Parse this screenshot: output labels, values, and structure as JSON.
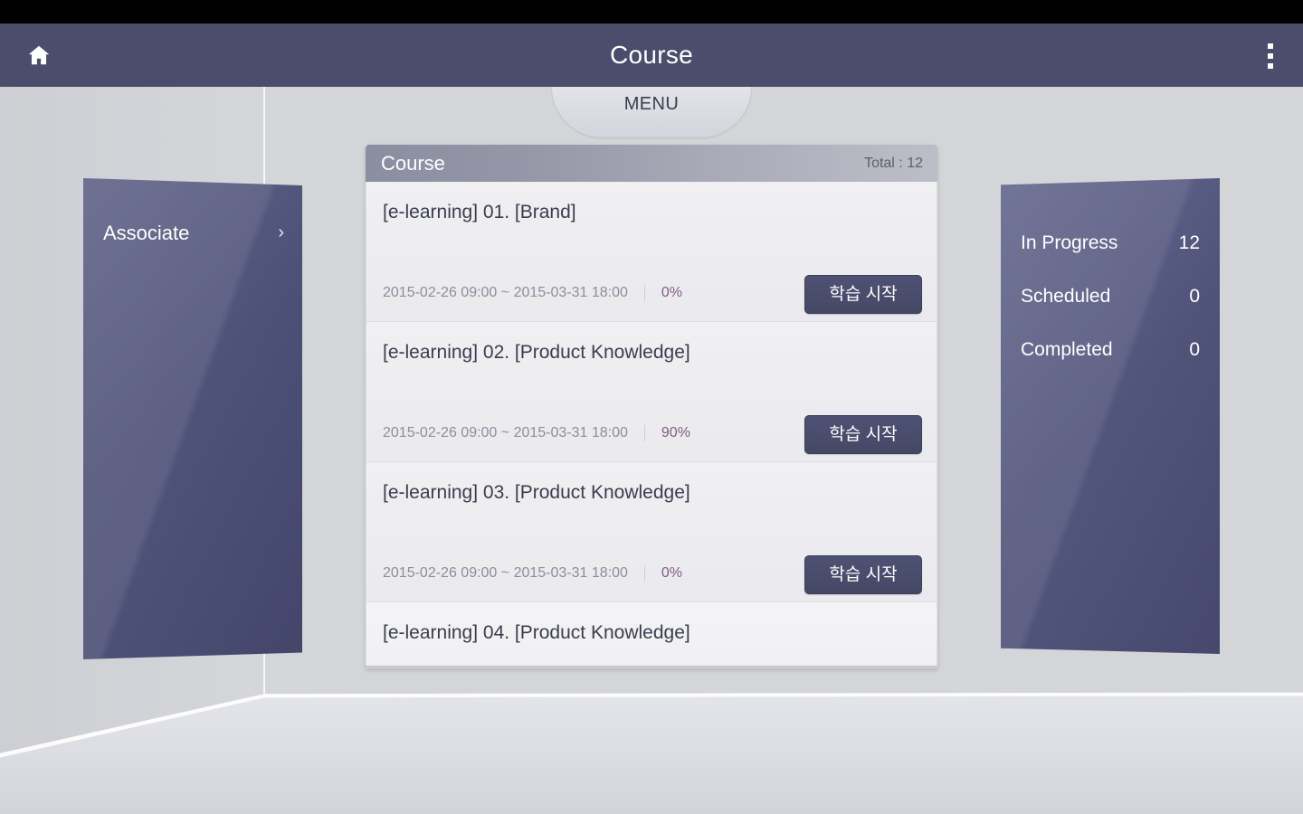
{
  "app_bar": {
    "title": "Course",
    "home_icon": "home-icon",
    "overflow_icon": "more-vert-icon"
  },
  "menu_tab": {
    "label": "MENU"
  },
  "left_panel": {
    "label": "Associate",
    "chevron_icon": "chevron-right-icon"
  },
  "right_panel": {
    "stats": [
      {
        "label": "In Progress",
        "value": "12"
      },
      {
        "label": "Scheduled",
        "value": "0"
      },
      {
        "label": "Completed",
        "value": "0"
      }
    ]
  },
  "course_card": {
    "header_title": "Course",
    "total_label": "Total : 12",
    "items": [
      {
        "title": "[e-learning]  01. [Brand]",
        "dates": "2015-02-26 09:00 ~ 2015-03-31 18:00",
        "progress": "0%",
        "button_label": "학습 시작"
      },
      {
        "title": "[e-learning]  02. [Product Knowledge]",
        "dates": "2015-02-26 09:00 ~ 2015-03-31 18:00",
        "progress": "90%",
        "button_label": "학습 시작"
      },
      {
        "title": "[e-learning]  03. [Product Knowledge]",
        "dates": "2015-02-26 09:00 ~ 2015-03-31 18:00",
        "progress": "0%",
        "button_label": "학습 시작"
      },
      {
        "title": "[e-learning]  04. [Product Knowledge]",
        "dates": "",
        "progress": "",
        "button_label": ""
      }
    ]
  },
  "colors": {
    "app_bar": "#4a4d6b",
    "panel_purple": "#4c4f76",
    "button_navy": "#474a64",
    "progress_text": "#7f5d80",
    "background": "#d3d5d9"
  }
}
